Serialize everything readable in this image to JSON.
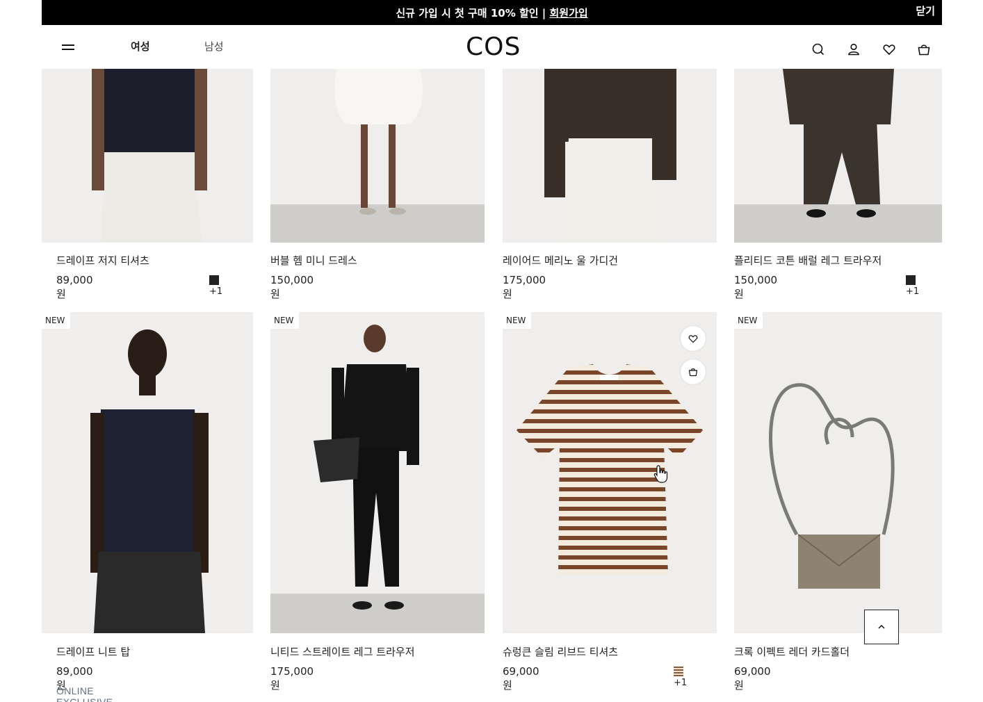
{
  "banner": {
    "message": "신규 가입 시 첫 구매 10% 할인 | ",
    "link": "회원가입",
    "close": "닫기"
  },
  "header": {
    "menu_icon": "hamburger-icon",
    "nav": {
      "women": "여성",
      "men": "남성"
    },
    "logo": "COS",
    "icons": [
      "search-icon",
      "account-icon",
      "wishlist-icon",
      "bag-icon"
    ]
  },
  "products_row1": [
    {
      "name": "드레이프 저지 티셔츠",
      "price": "89,000원",
      "swatch_color": "#222222",
      "swatch_extra": "+1"
    },
    {
      "name": "버블 헴 미니 드레스",
      "price": "150,000원"
    },
    {
      "name": "레이어드 메리노 울 가디건",
      "price": "175,000원"
    },
    {
      "name": "플리티드 코튼 배럴 레그 트라우저",
      "price": "150,000원",
      "swatch_color": "#222222",
      "swatch_extra": "+1"
    }
  ],
  "products_row2": [
    {
      "badge": "NEW",
      "name": "드레이프 니트 탑",
      "price": "89,000원",
      "tag": "ONLINE EXCLUSIVE"
    },
    {
      "badge": "NEW",
      "name": "니티드 스트레이트 레그 트라우저",
      "price": "175,000원"
    },
    {
      "badge": "NEW",
      "name": "슈렁큰 슬림 리브드 티셔츠",
      "price": "69,000원",
      "swatch_color": "#8a5a3a",
      "swatch_extra": "+1"
    },
    {
      "badge": "NEW",
      "name": "크록 이펙트 레더 카드홀더",
      "price": "69,000원"
    }
  ],
  "controls": {
    "back_to_top_icon": "chevron-up-icon",
    "cursor_icon": "hand-pointer-icon"
  }
}
